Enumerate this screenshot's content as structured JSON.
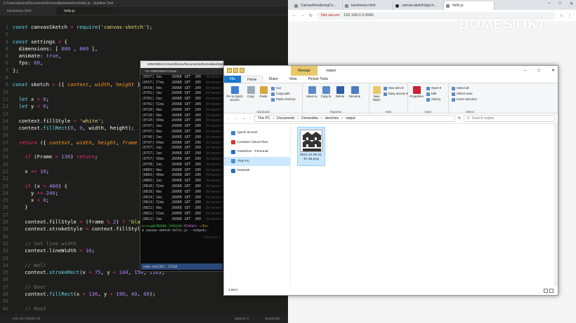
{
  "sublime": {
    "title": "C:\\Users\\bruno\\Documents\\Domestika\\sketches\\hello.js - Sublime Text",
    "tabs": [
      "barebones.html",
      "hello.js"
    ],
    "status_left": "Line 19, Column 20",
    "status_spaces": "Spaces: 2",
    "status_syntax": "JavaScript",
    "code_lines": [
      {
        "n": "1",
        "t": [
          [
            "kw",
            "const "
          ],
          [
            "",
            "canvasSketch "
          ],
          [
            "op",
            "= "
          ],
          [
            "fn",
            "require"
          ],
          [
            "",
            "("
          ],
          [
            "str",
            "'canvas-sketch'"
          ],
          [
            "",
            ");"
          ]
        ]
      },
      {
        "n": "2",
        "t": []
      },
      {
        "n": "3",
        "t": [
          [
            "kw",
            "const "
          ],
          [
            "",
            "settings "
          ],
          [
            "op",
            "= "
          ],
          [
            "",
            "{"
          ]
        ]
      },
      {
        "n": "4",
        "t": [
          [
            "",
            "  dimensions: [ "
          ],
          [
            "nm",
            "800"
          ],
          [
            "",
            " , "
          ],
          [
            "nm",
            "800"
          ],
          [
            "",
            " ],"
          ]
        ]
      },
      {
        "n": "5",
        "t": [
          [
            "",
            "  animate: "
          ],
          [
            "nm",
            "true"
          ],
          [
            "",
            ","
          ]
        ]
      },
      {
        "n": "6",
        "t": [
          [
            "",
            "  fps: "
          ],
          [
            "nm",
            "60"
          ],
          [
            "",
            ","
          ]
        ]
      },
      {
        "n": "7",
        "t": [
          [
            "",
            "};"
          ]
        ]
      },
      {
        "n": "8",
        "t": []
      },
      {
        "n": "9",
        "t": [
          [
            "kw",
            "const "
          ],
          [
            "",
            "sketch "
          ],
          [
            "op",
            "= "
          ],
          [
            "",
            "({ "
          ],
          [
            "prm",
            "context"
          ],
          [
            "",
            ", "
          ],
          [
            "prm",
            "width"
          ],
          [
            "",
            ", "
          ],
          [
            "prm",
            "height"
          ],
          [
            "",
            " }) "
          ],
          [
            "kw",
            "=>"
          ],
          [
            "",
            " {"
          ]
        ]
      },
      {
        "n": "10",
        "t": []
      },
      {
        "n": "11",
        "t": [
          [
            "",
            "  "
          ],
          [
            "kw",
            "let "
          ],
          [
            "",
            "x "
          ],
          [
            "op",
            "= "
          ],
          [
            "nm",
            "0"
          ],
          [
            "",
            ";"
          ]
        ]
      },
      {
        "n": "12",
        "t": [
          [
            "",
            "  "
          ],
          [
            "kw",
            "let "
          ],
          [
            "",
            "y "
          ],
          [
            "op",
            "= "
          ],
          [
            "nm",
            "0"
          ],
          [
            "",
            ";"
          ]
        ]
      },
      {
        "n": "13",
        "t": []
      },
      {
        "n": "14",
        "t": [
          [
            "",
            "  context.fillStyle "
          ],
          [
            "op",
            "= "
          ],
          [
            "str",
            "'white'"
          ],
          [
            "",
            ";"
          ]
        ]
      },
      {
        "n": "15",
        "t": [
          [
            "",
            "  context."
          ],
          [
            "fn",
            "fillRect"
          ],
          [
            "",
            "("
          ],
          [
            "nm",
            "0"
          ],
          [
            "",
            ", "
          ],
          [
            "nm",
            "0"
          ],
          [
            "",
            ", width, height);"
          ]
        ]
      },
      {
        "n": "16",
        "t": []
      },
      {
        "n": "17",
        "t": [
          [
            "",
            "  "
          ],
          [
            "op",
            "return "
          ],
          [
            "",
            "({ "
          ],
          [
            "prm",
            "context"
          ],
          [
            "",
            ", "
          ],
          [
            "prm",
            "width"
          ],
          [
            "",
            ", "
          ],
          [
            "prm",
            "height"
          ],
          [
            "",
            ", "
          ],
          [
            "prm",
            "frame"
          ],
          [
            "",
            " }) "
          ],
          [
            "kw",
            "=>"
          ],
          [
            "",
            " {"
          ]
        ]
      },
      {
        "n": "18",
        "t": []
      },
      {
        "n": "19",
        "t": [
          [
            "",
            "    "
          ],
          [
            "op",
            "if "
          ],
          [
            "",
            "(Frame "
          ],
          [
            "op",
            "> "
          ],
          [
            "nm",
            "138"
          ],
          [
            "",
            ") "
          ],
          [
            "op",
            "return"
          ],
          [
            "",
            ";"
          ]
        ]
      },
      {
        "n": "20",
        "t": []
      },
      {
        "n": "21",
        "t": [
          [
            "",
            "    x "
          ],
          [
            "op",
            "+= "
          ],
          [
            "nm",
            "10"
          ],
          [
            "",
            ";"
          ]
        ]
      },
      {
        "n": "22",
        "t": []
      },
      {
        "n": "23",
        "t": [
          [
            "",
            "    "
          ],
          [
            "op",
            "if "
          ],
          [
            "",
            "(x "
          ],
          [
            "op",
            "> "
          ],
          [
            "nm",
            "460"
          ],
          [
            "",
            ") {"
          ]
        ]
      },
      {
        "n": "24",
        "t": [
          [
            "",
            "      y "
          ],
          [
            "op",
            "+= "
          ],
          [
            "nm",
            "240"
          ],
          [
            "",
            ";"
          ]
        ]
      },
      {
        "n": "25",
        "t": [
          [
            "",
            "      x "
          ],
          [
            "op",
            "= "
          ],
          [
            "nm",
            "0"
          ],
          [
            "",
            ";"
          ]
        ]
      },
      {
        "n": "26",
        "t": [
          [
            "",
            "    }"
          ]
        ]
      },
      {
        "n": "27",
        "t": []
      },
      {
        "n": "28",
        "t": [
          [
            "",
            "    context.fillStyle "
          ],
          [
            "op",
            "= "
          ],
          [
            "",
            "(frame "
          ],
          [
            "op",
            "% "
          ],
          [
            "nm",
            "2"
          ],
          [
            "",
            ") "
          ],
          [
            "op",
            "? "
          ],
          [
            "str",
            "'black"
          ]
        ]
      },
      {
        "n": "29",
        "t": [
          [
            "",
            "    context.strokeStyle "
          ],
          [
            "op",
            "= "
          ],
          [
            "",
            "context.fillStyle;"
          ]
        ]
      },
      {
        "n": "30",
        "t": []
      },
      {
        "n": "31",
        "t": [
          [
            "cm",
            "    // Set line width"
          ]
        ]
      },
      {
        "n": "32",
        "t": [
          [
            "",
            "    context.lineWidth "
          ],
          [
            "op",
            "= "
          ],
          [
            "nm",
            "10"
          ],
          [
            "",
            ";"
          ]
        ]
      },
      {
        "n": "33",
        "t": []
      },
      {
        "n": "34",
        "t": [
          [
            "cm",
            "    // Wall"
          ]
        ]
      },
      {
        "n": "35",
        "t": [
          [
            "",
            "    context."
          ],
          [
            "fn",
            "strokeRect"
          ],
          [
            "",
            "(x "
          ],
          [
            "op",
            "+ "
          ],
          [
            "nm",
            "75"
          ],
          [
            "",
            ", y "
          ],
          [
            "op",
            "+ "
          ],
          [
            "nm",
            "140"
          ],
          [
            "",
            ", "
          ],
          [
            "nm",
            "150"
          ],
          [
            "",
            ", "
          ],
          [
            "nm",
            "110"
          ],
          [
            "",
            ");"
          ]
        ]
      },
      {
        "n": "36",
        "t": []
      },
      {
        "n": "37",
        "t": [
          [
            "cm",
            "    // Door"
          ]
        ]
      },
      {
        "n": "38",
        "t": [
          [
            "",
            "    context."
          ],
          [
            "fn",
            "fillRect"
          ],
          [
            "",
            "(x "
          ],
          [
            "op",
            "+ "
          ],
          [
            "nm",
            "130"
          ],
          [
            "",
            ", y "
          ],
          [
            "op",
            "+ "
          ],
          [
            "nm",
            "190"
          ],
          [
            "",
            ", "
          ],
          [
            "nm",
            "40"
          ],
          [
            "",
            ", "
          ],
          [
            "nm",
            "60"
          ],
          [
            "",
            ");"
          ]
        ]
      },
      {
        "n": "39",
        "t": []
      },
      {
        "n": "40",
        "t": [
          [
            "cm",
            "    // Roof"
          ]
        ]
      }
    ]
  },
  "bash": {
    "title": "MINGW64:/c/Users/bruno/Documents/Domestika/sketches",
    "tab": "<1> MINGW64:/c/User...",
    "rows": [
      [
        "[0557]",
        "1ms",
        "266KB",
        "GET",
        "200",
        "(browser)"
      ],
      [
        "[0557]",
        "57ms",
        "266KB",
        "GET",
        "200",
        "(browser)"
      ],
      [
        "[0558]",
        "0ms",
        "266KB",
        "GET",
        "200",
        "(browser)"
      ],
      [
        "[0701]",
        "1ms",
        "266KB",
        "GET",
        "200",
        "(browser)"
      ],
      [
        "[0701]",
        "1ms",
        "266KB",
        "GET",
        "200",
        "(browser)"
      ],
      [
        "[0701]",
        "51ms",
        "266KB",
        "GET",
        "200",
        "(browser)"
      ],
      [
        "[0720]",
        "0ms",
        "266KB",
        "GET",
        "200",
        "(browser)"
      ],
      [
        "[0720]",
        "0ms",
        "266KB",
        "GET",
        "200",
        "(browser)"
      ],
      [
        "[0720]",
        "50ms",
        "266KB",
        "GET",
        "200",
        "(browser)"
      ],
      [
        "[0747]",
        "1ms",
        "266KB",
        "GET",
        "200",
        "(browser)"
      ],
      [
        "[0747]",
        "0ms",
        "266KB",
        "GET",
        "200",
        "(browser)"
      ],
      [
        "[0746]",
        "1ms",
        "266KB",
        "GET",
        "200",
        "(browser)"
      ],
      [
        "[0747]",
        "54ms",
        "266KB",
        "GET",
        "200",
        "(browser)"
      ],
      [
        "[0757]",
        "1ms",
        "266KB",
        "GET",
        "200",
        "(browser)"
      ],
      [
        "[0757]",
        "1ms",
        "266KB",
        "GET",
        "200",
        "(browser)"
      ],
      [
        "[0757]",
        "58ms",
        "266KB",
        "GET",
        "200",
        "(browser)"
      ],
      [
        "[0758]",
        "1ms",
        "266KB",
        "GET",
        "200",
        "(browser)"
      ],
      [
        "[0803]",
        "0ms",
        "266KB",
        "GET",
        "200",
        "(browser)"
      ],
      [
        "[0803]",
        "48ms",
        "266KB",
        "GET",
        "200",
        "(browser)"
      ],
      [
        "[0803]",
        "1ms",
        "266KB",
        "GET",
        "200",
        "(browser)"
      ],
      [
        "[0810]",
        "52ms",
        "266KB",
        "GET",
        "200",
        "(browser)"
      ],
      [
        "[0810]",
        "0ms",
        "266KB",
        "GET",
        "200",
        "(browser)"
      ],
      [
        "[0814]",
        "1ms",
        "266KB",
        "GET",
        "200",
        "(browser)"
      ],
      [
        "[0814]",
        "52ms",
        "266KB",
        "GET",
        "200",
        "(browser)"
      ],
      [
        "[0821]",
        "0ms",
        "266KB",
        "GET",
        "200",
        "(browser)"
      ],
      [
        "[0821]",
        "51ms",
        "266KB",
        "GET",
        "200",
        "(browser)"
      ],
      [
        "[0821]",
        "1ms",
        "266KB",
        "GET",
        "200",
        "(browser)"
      ]
    ],
    "prompt_user": "bruno@WINDOWS-1U86VA0",
    "prompt_env": "MINGW64",
    "prompt_path": "~/Doc",
    "command": "$ canvas-sketch hello.js --output=",
    "browser_tag": "(browser)",
    "node_label": "node.exe[34]: 27120"
  },
  "browser": {
    "tabs": [
      "CanvasRenderingCo...",
      "barebones.html",
      "canvas-sketch/api.m...",
      "hello.js"
    ],
    "not_secure": "Not secure",
    "url": "192.168.0.3:9966",
    "logo": "DOMESTIKA"
  },
  "explorer": {
    "manage_tab": "Manage",
    "folder_title": "output",
    "ribbon_tabs": [
      "File",
      "Home",
      "Share",
      "View",
      "Picture Tools"
    ],
    "groups": {
      "clipboard": {
        "label": "Clipboard",
        "pin": "Pin to Quick access",
        "copy": "Copy",
        "paste": "Paste",
        "cut": "Cut",
        "copy_path": "Copy path",
        "paste_shortcut": "Paste shortcut"
      },
      "organise": {
        "label": "Organise",
        "move_to": "Move to",
        "copy_to": "Copy to",
        "delete": "Delete",
        "rename": "Rename"
      },
      "new": {
        "label": "New",
        "new_folder": "New folder",
        "new_item": "New item ▾",
        "easy_access": "Easy access ▾"
      },
      "open": {
        "label": "Open",
        "properties": "Properties",
        "open": "Open ▾",
        "edit": "Edit",
        "history": "History"
      },
      "select": {
        "label": "Select",
        "select_all": "Select all",
        "select_none": "Select none",
        "invert": "Invert selection"
      }
    },
    "path": [
      "This PC",
      "Documents",
      "Domestika",
      "sketches",
      "output"
    ],
    "search_placeholder": "Search output",
    "sidebar": [
      "Quick access",
      "Creative Cloud Files",
      "OneDrive - Personal",
      "This PC",
      "Network"
    ],
    "file_name": "2021.12.25-21.57.25.png",
    "status": "1 item"
  }
}
